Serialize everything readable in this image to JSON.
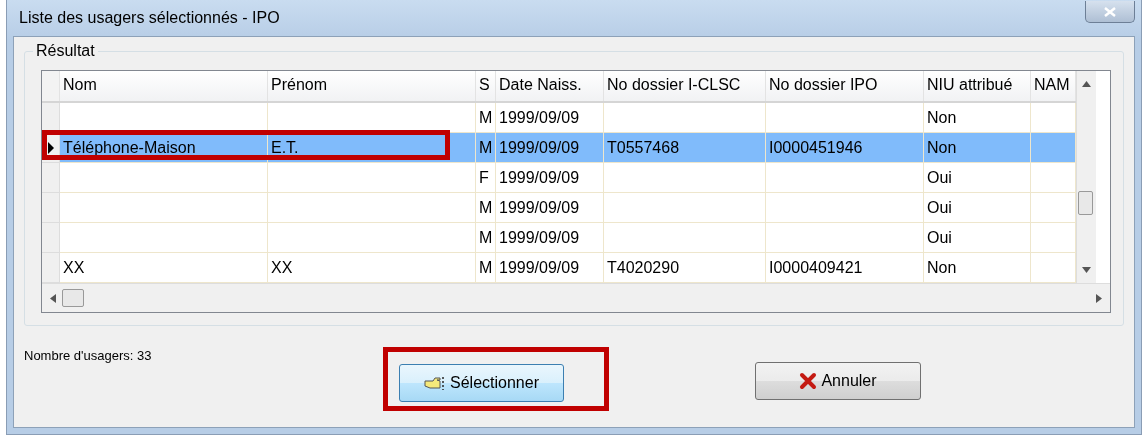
{
  "window": {
    "title": "Liste des usagers sélectionnés - IPO"
  },
  "group": {
    "label": "Résultat"
  },
  "table": {
    "columns": [
      "Nom",
      "Prénom",
      "S",
      "Date Naiss.",
      "No dossier I-CLSC",
      "No dossier IPO",
      "NIU attribué",
      "NAM"
    ],
    "rows": [
      {
        "selected": false,
        "annotated": false,
        "cells": [
          "",
          "",
          "M",
          "1999/09/09",
          "",
          "",
          "Non",
          ""
        ]
      },
      {
        "selected": true,
        "annotated": true,
        "cells": [
          "Téléphone-Maison",
          "E.T.",
          "M",
          "1999/09/09",
          "T0557468",
          "I0000451946",
          "Non",
          ""
        ]
      },
      {
        "selected": false,
        "annotated": false,
        "cells": [
          "",
          "",
          "F",
          "1999/09/09",
          "",
          "",
          "Oui",
          ""
        ]
      },
      {
        "selected": false,
        "annotated": false,
        "cells": [
          "",
          "",
          "M",
          "1999/09/09",
          "",
          "",
          "Oui",
          ""
        ]
      },
      {
        "selected": false,
        "annotated": false,
        "cells": [
          "",
          "",
          "M",
          "1999/09/09",
          "",
          "",
          "Oui",
          ""
        ]
      },
      {
        "selected": false,
        "annotated": false,
        "cells": [
          "XX",
          "XX",
          "M",
          "1999/09/09",
          "T4020290",
          "I0000409421",
          "Non",
          ""
        ]
      }
    ]
  },
  "count_label": "Nombre d'usagers: 33",
  "buttons": [
    {
      "kind": "select",
      "label": "Sélectionner",
      "annotated": true
    },
    {
      "kind": "cancel",
      "label": "Annuler",
      "annotated": false
    }
  ]
}
